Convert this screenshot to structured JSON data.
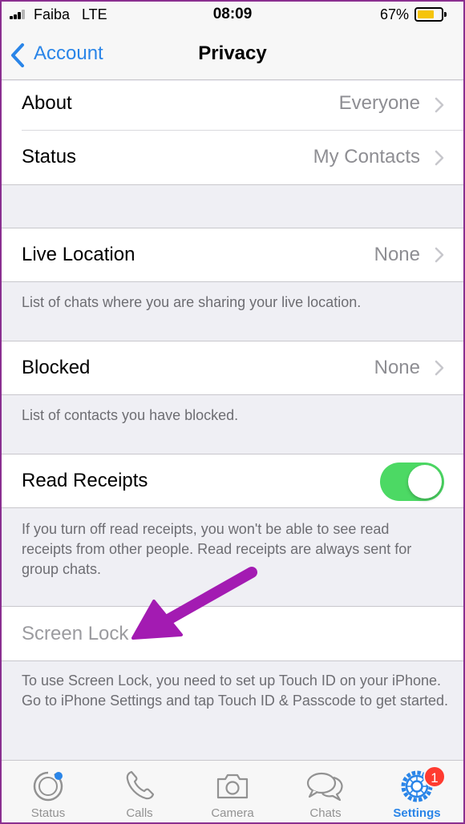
{
  "status_bar": {
    "carrier": "Faiba",
    "network": "LTE",
    "time": "08:09",
    "battery": "67%"
  },
  "nav": {
    "back_label": "Account",
    "title": "Privacy"
  },
  "rows": {
    "about": {
      "label": "About",
      "value": "Everyone"
    },
    "status": {
      "label": "Status",
      "value": "My Contacts"
    },
    "live_location": {
      "label": "Live Location",
      "value": "None"
    },
    "blocked": {
      "label": "Blocked",
      "value": "None"
    },
    "read_receipts": {
      "label": "Read Receipts",
      "on": true
    },
    "screen_lock": {
      "label": "Screen Lock"
    }
  },
  "footers": {
    "live_location": "List of chats where you are sharing your live location.",
    "blocked": "List of contacts you have blocked.",
    "read_receipts": "If you turn off read receipts, you won't be able to see read receipts from other people. Read receipts are always sent for group chats.",
    "screen_lock": "To use Screen Lock, you need to set up Touch ID on your iPhone. Go to iPhone Settings and tap Touch ID & Passcode to get started."
  },
  "tabs": [
    {
      "label": "Status",
      "icon": "status-icon"
    },
    {
      "label": "Calls",
      "icon": "phone-icon"
    },
    {
      "label": "Camera",
      "icon": "camera-icon"
    },
    {
      "label": "Chats",
      "icon": "chat-bubbles-icon"
    },
    {
      "label": "Settings",
      "icon": "gear-icon",
      "active": true,
      "badge": "1"
    }
  ],
  "colors": {
    "accent": "#2a85e8",
    "toggle_on": "#4cd964",
    "badge": "#ff3b30",
    "annotation_arrow": "#a31bb2"
  }
}
